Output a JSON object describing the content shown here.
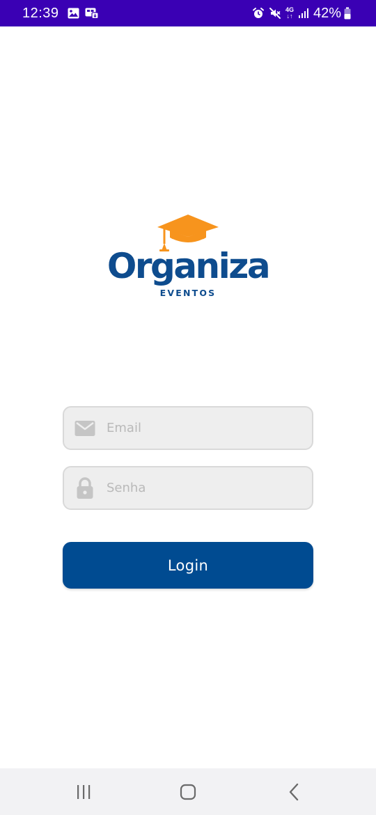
{
  "status_bar": {
    "time": "12:39",
    "network": "4G",
    "battery": "42%",
    "background_color": "#3a00b4",
    "left_icons": [
      "gallery-icon",
      "download-notification-icon"
    ],
    "right_icons": [
      "alarm-icon",
      "mute-icon",
      "signal-icon",
      "battery-icon"
    ]
  },
  "logo": {
    "icon": "graduation-cap-icon",
    "name": "Organiza",
    "subtitle": "EVENTOS",
    "primary_color": "#0e4c8e",
    "cap_color": "#f7941d"
  },
  "form": {
    "email": {
      "icon": "mail-icon",
      "value": "",
      "placeholder": "Email"
    },
    "password": {
      "icon": "lock-icon",
      "value": "",
      "placeholder": "Senha"
    },
    "submit": {
      "label": "Login",
      "color": "#004b91"
    }
  },
  "nav_bar": {
    "buttons": [
      "recents-icon",
      "home-icon",
      "back-icon"
    ]
  }
}
